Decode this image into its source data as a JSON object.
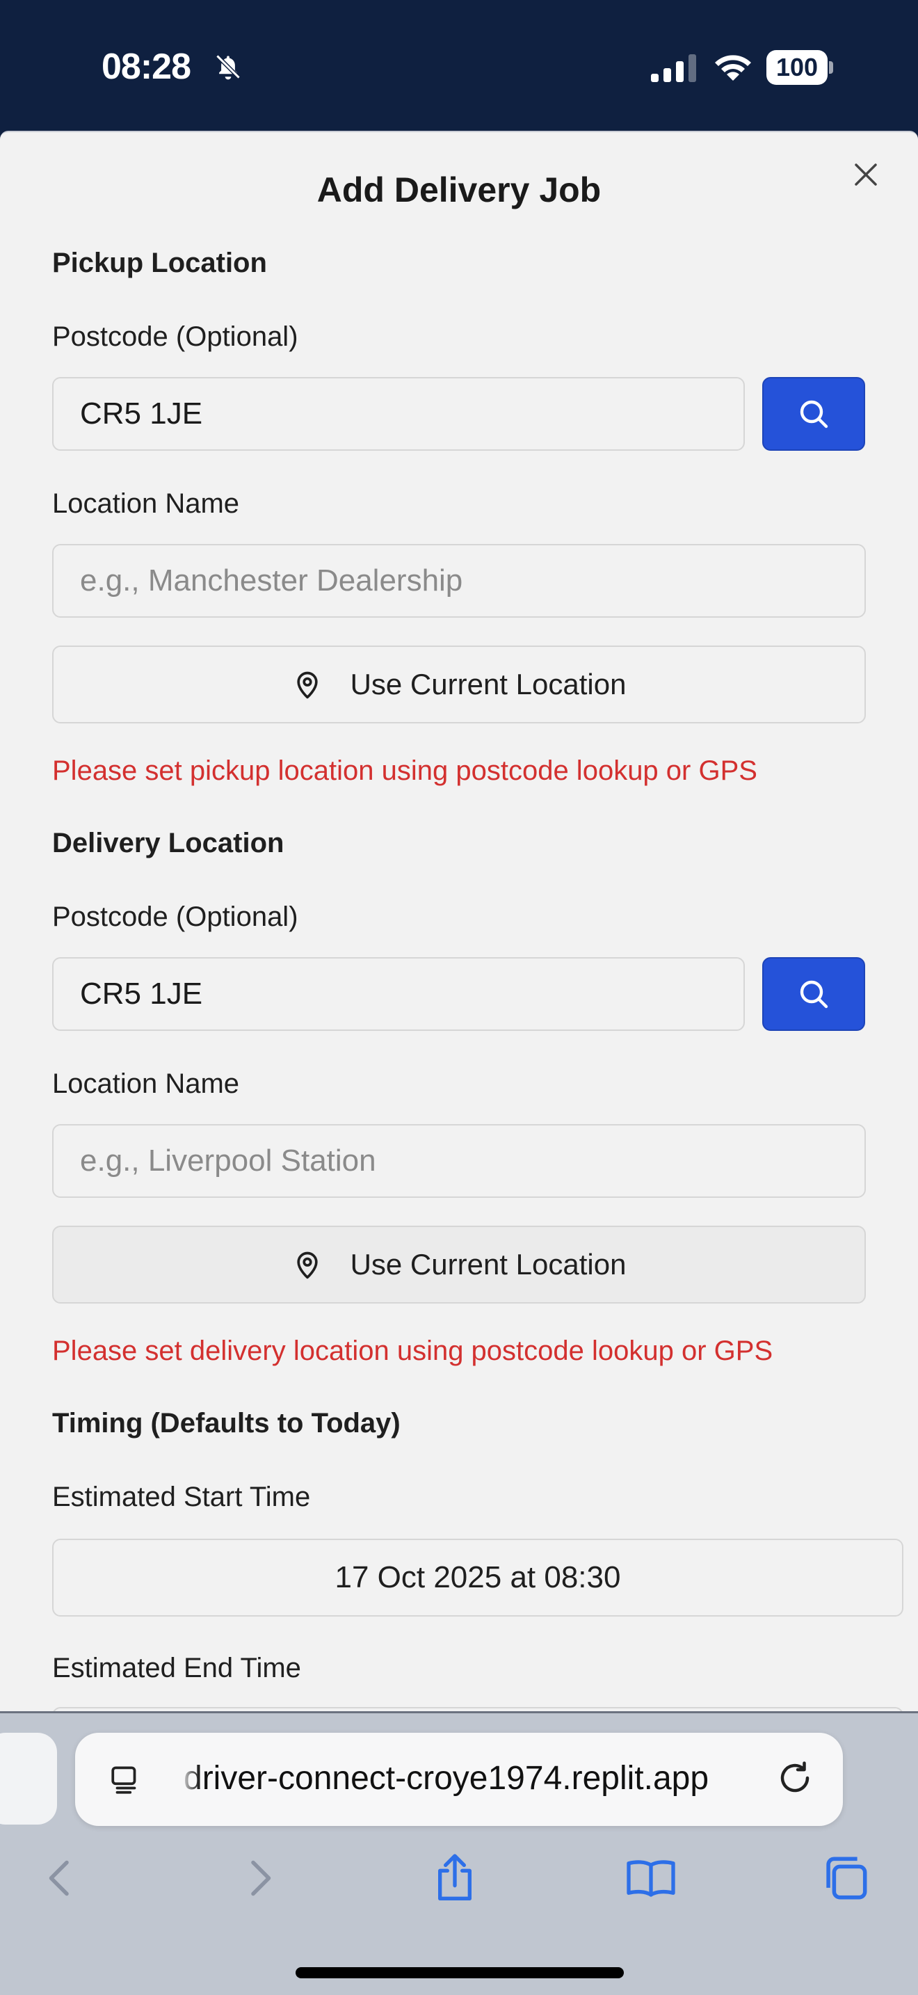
{
  "status": {
    "time": "08:28",
    "battery": "100"
  },
  "modal": {
    "title": "Add Delivery Job",
    "pickup": {
      "section_title": "Pickup Location",
      "postcode_label": "Postcode (Optional)",
      "postcode_value": "CR5 1JE",
      "location_label": "Location Name",
      "location_placeholder": "e.g., Manchester Dealership",
      "gps_label": "Use Current Location",
      "error": "Please set pickup location using postcode lookup or GPS"
    },
    "delivery": {
      "section_title": "Delivery Location",
      "postcode_label": "Postcode (Optional)",
      "postcode_value": "CR5 1JE",
      "location_label": "Location Name",
      "location_placeholder": "e.g., Liverpool Station",
      "gps_label": "Use Current Location",
      "error": "Please set delivery location using postcode lookup or GPS"
    },
    "timing": {
      "section_title": "Timing (Defaults to Today)",
      "start_label": "Estimated Start Time",
      "start_value": "17 Oct 2025 at 08:30",
      "end_label": "Estimated End Time"
    }
  },
  "browser": {
    "url": "driver-connect-croye1974.replit.app"
  },
  "colors": {
    "accent": "#2552d9",
    "error": "#d3302f",
    "status_bar": "#0f2040"
  },
  "icons": [
    "bell-slash-icon",
    "signal-icon",
    "wifi-icon",
    "battery-icon",
    "close-icon",
    "search-icon",
    "map-pin-icon",
    "reader-icon",
    "reload-icon",
    "back-icon",
    "forward-icon",
    "share-icon",
    "bookmarks-icon",
    "tabs-icon"
  ]
}
